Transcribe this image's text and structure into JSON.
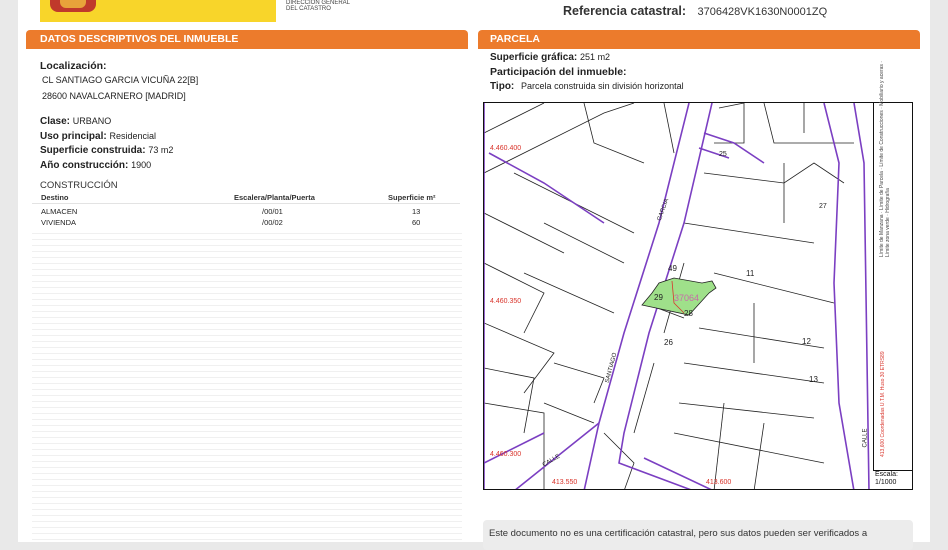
{
  "header": {
    "agency_line1": "DIRECCIÓN GENERAL",
    "agency_line2": "DEL CATASTRO",
    "ref_label": "Referencia catastral:",
    "ref_value": "3706428VK1630N0001ZQ"
  },
  "left": {
    "section_title": "DATOS DESCRIPTIVOS DEL INMUEBLE",
    "localizacion_label": "Localización:",
    "address_line1": "CL SANTIAGO GARCIA VICUÑA 22[B]",
    "address_line2": "28600 NAVALCARNERO [MADRID]",
    "clase_label": "Clase:",
    "clase_value": "URBANO",
    "uso_label": "Uso principal:",
    "uso_value": "Residencial",
    "sup_label": "Superficie construida:",
    "sup_value": "73 m2",
    "anio_label": "Año construcción:",
    "anio_value": "1900",
    "construccion_title": "CONSTRUCCIÓN",
    "table_headers": [
      "Destino",
      "Escalera/Planta/Puerta",
      "Superficie m²"
    ],
    "table_rows": [
      [
        "ALMACEN",
        "/00/01",
        "13"
      ],
      [
        "VIVIENDA",
        "/00/02",
        "60"
      ]
    ]
  },
  "right": {
    "section_title": "PARCELA",
    "sup_grafica_label": "Superficie gráfica:",
    "sup_grafica_value": "251 m2",
    "participacion_label": "Participación del inmueble:",
    "tipo_label": "Tipo:",
    "tipo_value": "Parcela construida sin división horizontal"
  },
  "map": {
    "coord_labels": [
      "4.460.400",
      "4.460.350",
      "4.460.300",
      "413.550",
      "413.600"
    ],
    "parcel_numbers": [
      "11",
      "12",
      "13",
      "26",
      "28",
      "29",
      "49",
      "25",
      "27"
    ],
    "parcel_id": "37064",
    "street_labels": [
      "SANTIAGO",
      "GARCIA",
      "CALLE",
      "CALLE"
    ],
    "legend_items": [
      "Límite de Manzana",
      "Límite de Parcela",
      "Límite de Construcciones",
      "Mobiliario y aceras",
      "Límite zona verde",
      "Hidrografía"
    ],
    "projection_note": "413,600 Coordenadas U.T.M. Huso 30 ETRS89",
    "scale_label": "Escala:",
    "scale_value": "1/1000"
  },
  "notice": {
    "text": "Este documento no es una certificación catastral, pero sus datos pueden ser verificados a"
  },
  "colors": {
    "accent_orange": "#ec7b2c",
    "parcel_green": "#9fe08a",
    "street_purple": "#7b3fc2",
    "coord_red": "#d9342b"
  }
}
